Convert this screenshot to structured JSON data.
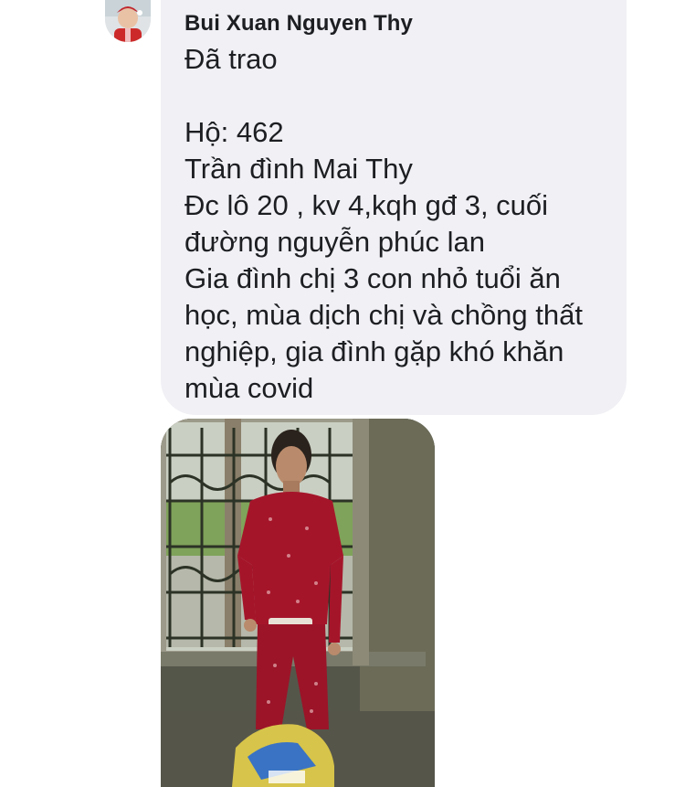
{
  "message": {
    "sender_name": "Bui Xuan Nguyen Thy",
    "text": "Đã trao\n\nHộ: 462\nTrần đình Mai Thy\nĐc lô 20 , kv 4,kqh gđ 3, cuối\nđường nguyễn phúc lan\nGia đình chị 3 con nhỏ tuổi ăn\nhọc, mùa dịch chị và chồng thất\nnghiệp, gia đình gặp khó khăn\nmùa covid"
  },
  "colors": {
    "bubble_background": "#f0f0f5",
    "text": "#1c1e21",
    "page_background": "#ffffff"
  },
  "icons": {
    "avatar": "profile-photo",
    "attachment": "photo-attachment"
  }
}
